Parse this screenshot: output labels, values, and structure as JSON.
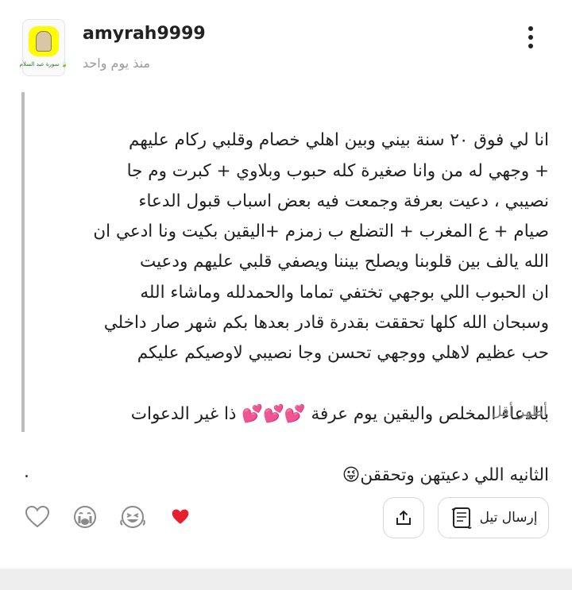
{
  "header": {
    "username": "amyrah9999",
    "timestamp": "منذ يوم واحد",
    "avatar_caption": "سورة عبد السلام 🍃"
  },
  "post": {
    "body": "انا لي فوق ٢٠ سنة بيني وبين اهلي خصام  وقلبي ركام عليهم\n+ وجهي له من وانا صغيرة كله حبوب وبلاوي + كبرت وم جا\nنصيبي ، دعيت بعرفة وجمعت فيه بعض اسباب قبول الدعاء\nصيام + ع المغرب + التضلع ب زمزم +اليقين بكيت ونا ادعي ان\nالله يالف بين قلوبنا ويصلح بيننا ويصفي قلبي عليهم ودعيت\nان الحبوب اللي بوجهي تختفي تماما والحمدلله وماشاء الله\nوسبحان الله كلها تحققت بقدرة قادر بعدها بكم شهر صار داخلي\nحب عظيم لاهلي ووجهي تحسن وجا نصيبي لاوصيكم عليكم",
    "line9_text": "بالدعاء المخلص واليقين يوم عرفة ",
    "line9_emoji": "💕💕💕",
    "line9_tail": " ذا غير الدعوات",
    "line10_emoji": "😜",
    "line10_text": "الثانيه اللي دعيتهن وتحققن",
    "show_less": "أظهر أقل"
  },
  "footer": {
    "dot": ".",
    "send_label": "إرسال تيل"
  },
  "icons": {
    "more": "more-vertical-icon",
    "like": "heart-outline-icon",
    "cry": "crying-face-icon",
    "laugh": "laughing-face-icon",
    "heart": "red-heart-icon",
    "share": "share-upload-icon",
    "send": "scroll-icon"
  },
  "colors": {
    "accent_heart": "#e8202e",
    "snap_yellow": "#fffc00",
    "muted_text": "#9a9a9a"
  }
}
